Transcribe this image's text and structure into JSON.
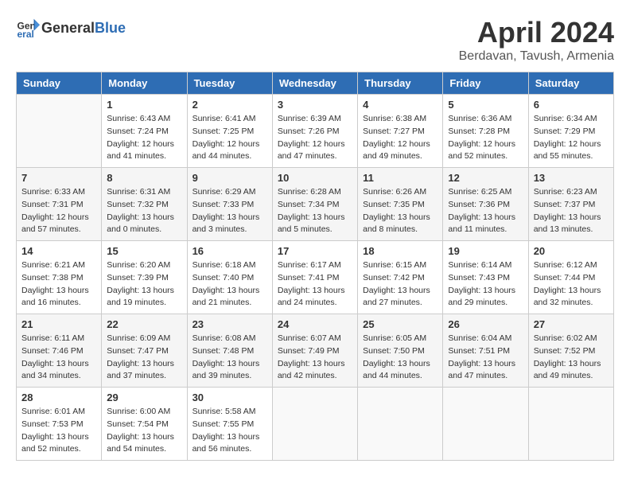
{
  "header": {
    "logo_general": "General",
    "logo_blue": "Blue",
    "month_title": "April 2024",
    "location": "Berdavan, Tavush, Armenia"
  },
  "columns": [
    "Sunday",
    "Monday",
    "Tuesday",
    "Wednesday",
    "Thursday",
    "Friday",
    "Saturday"
  ],
  "weeks": [
    [
      {
        "day": "",
        "info": ""
      },
      {
        "day": "1",
        "info": "Sunrise: 6:43 AM\nSunset: 7:24 PM\nDaylight: 12 hours\nand 41 minutes."
      },
      {
        "day": "2",
        "info": "Sunrise: 6:41 AM\nSunset: 7:25 PM\nDaylight: 12 hours\nand 44 minutes."
      },
      {
        "day": "3",
        "info": "Sunrise: 6:39 AM\nSunset: 7:26 PM\nDaylight: 12 hours\nand 47 minutes."
      },
      {
        "day": "4",
        "info": "Sunrise: 6:38 AM\nSunset: 7:27 PM\nDaylight: 12 hours\nand 49 minutes."
      },
      {
        "day": "5",
        "info": "Sunrise: 6:36 AM\nSunset: 7:28 PM\nDaylight: 12 hours\nand 52 minutes."
      },
      {
        "day": "6",
        "info": "Sunrise: 6:34 AM\nSunset: 7:29 PM\nDaylight: 12 hours\nand 55 minutes."
      }
    ],
    [
      {
        "day": "7",
        "info": "Sunrise: 6:33 AM\nSunset: 7:31 PM\nDaylight: 12 hours\nand 57 minutes."
      },
      {
        "day": "8",
        "info": "Sunrise: 6:31 AM\nSunset: 7:32 PM\nDaylight: 13 hours\nand 0 minutes."
      },
      {
        "day": "9",
        "info": "Sunrise: 6:29 AM\nSunset: 7:33 PM\nDaylight: 13 hours\nand 3 minutes."
      },
      {
        "day": "10",
        "info": "Sunrise: 6:28 AM\nSunset: 7:34 PM\nDaylight: 13 hours\nand 5 minutes."
      },
      {
        "day": "11",
        "info": "Sunrise: 6:26 AM\nSunset: 7:35 PM\nDaylight: 13 hours\nand 8 minutes."
      },
      {
        "day": "12",
        "info": "Sunrise: 6:25 AM\nSunset: 7:36 PM\nDaylight: 13 hours\nand 11 minutes."
      },
      {
        "day": "13",
        "info": "Sunrise: 6:23 AM\nSunset: 7:37 PM\nDaylight: 13 hours\nand 13 minutes."
      }
    ],
    [
      {
        "day": "14",
        "info": "Sunrise: 6:21 AM\nSunset: 7:38 PM\nDaylight: 13 hours\nand 16 minutes."
      },
      {
        "day": "15",
        "info": "Sunrise: 6:20 AM\nSunset: 7:39 PM\nDaylight: 13 hours\nand 19 minutes."
      },
      {
        "day": "16",
        "info": "Sunrise: 6:18 AM\nSunset: 7:40 PM\nDaylight: 13 hours\nand 21 minutes."
      },
      {
        "day": "17",
        "info": "Sunrise: 6:17 AM\nSunset: 7:41 PM\nDaylight: 13 hours\nand 24 minutes."
      },
      {
        "day": "18",
        "info": "Sunrise: 6:15 AM\nSunset: 7:42 PM\nDaylight: 13 hours\nand 27 minutes."
      },
      {
        "day": "19",
        "info": "Sunrise: 6:14 AM\nSunset: 7:43 PM\nDaylight: 13 hours\nand 29 minutes."
      },
      {
        "day": "20",
        "info": "Sunrise: 6:12 AM\nSunset: 7:44 PM\nDaylight: 13 hours\nand 32 minutes."
      }
    ],
    [
      {
        "day": "21",
        "info": "Sunrise: 6:11 AM\nSunset: 7:46 PM\nDaylight: 13 hours\nand 34 minutes."
      },
      {
        "day": "22",
        "info": "Sunrise: 6:09 AM\nSunset: 7:47 PM\nDaylight: 13 hours\nand 37 minutes."
      },
      {
        "day": "23",
        "info": "Sunrise: 6:08 AM\nSunset: 7:48 PM\nDaylight: 13 hours\nand 39 minutes."
      },
      {
        "day": "24",
        "info": "Sunrise: 6:07 AM\nSunset: 7:49 PM\nDaylight: 13 hours\nand 42 minutes."
      },
      {
        "day": "25",
        "info": "Sunrise: 6:05 AM\nSunset: 7:50 PM\nDaylight: 13 hours\nand 44 minutes."
      },
      {
        "day": "26",
        "info": "Sunrise: 6:04 AM\nSunset: 7:51 PM\nDaylight: 13 hours\nand 47 minutes."
      },
      {
        "day": "27",
        "info": "Sunrise: 6:02 AM\nSunset: 7:52 PM\nDaylight: 13 hours\nand 49 minutes."
      }
    ],
    [
      {
        "day": "28",
        "info": "Sunrise: 6:01 AM\nSunset: 7:53 PM\nDaylight: 13 hours\nand 52 minutes."
      },
      {
        "day": "29",
        "info": "Sunrise: 6:00 AM\nSunset: 7:54 PM\nDaylight: 13 hours\nand 54 minutes."
      },
      {
        "day": "30",
        "info": "Sunrise: 5:58 AM\nSunset: 7:55 PM\nDaylight: 13 hours\nand 56 minutes."
      },
      {
        "day": "",
        "info": ""
      },
      {
        "day": "",
        "info": ""
      },
      {
        "day": "",
        "info": ""
      },
      {
        "day": "",
        "info": ""
      }
    ]
  ]
}
